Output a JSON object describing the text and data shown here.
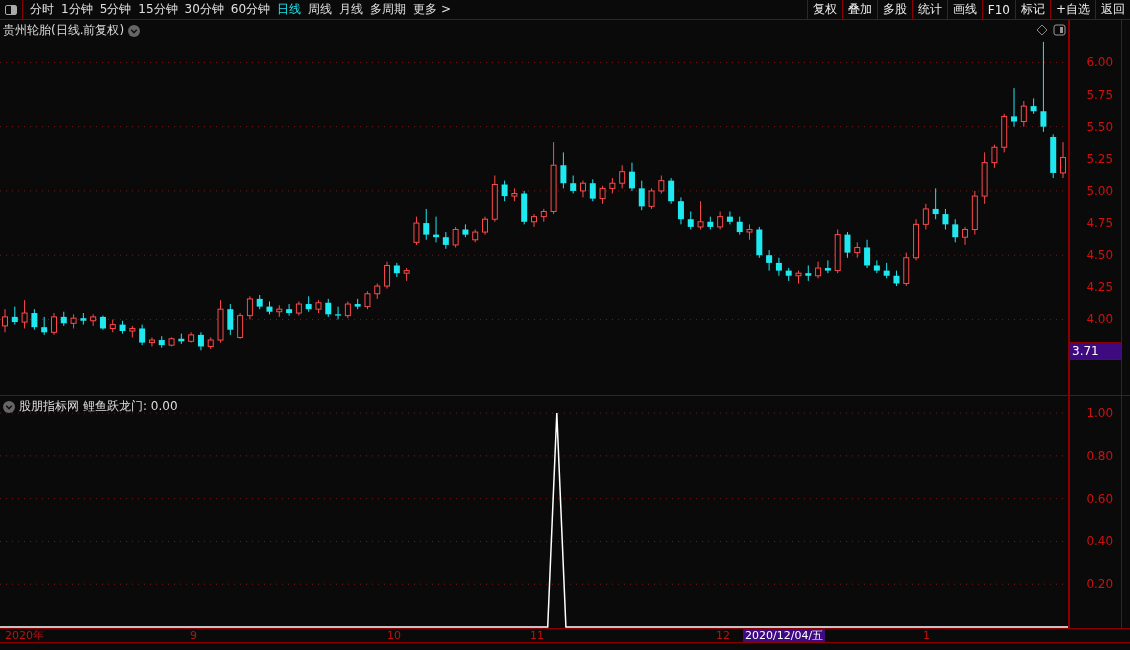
{
  "toolbar": {
    "periods": [
      {
        "label": "分时",
        "selected": false
      },
      {
        "label": "1分钟",
        "selected": false
      },
      {
        "label": "5分钟",
        "selected": false
      },
      {
        "label": "15分钟",
        "selected": false
      },
      {
        "label": "30分钟",
        "selected": false
      },
      {
        "label": "60分钟",
        "selected": false
      },
      {
        "label": "日线",
        "selected": true
      },
      {
        "label": "周线",
        "selected": false
      },
      {
        "label": "月线",
        "selected": false
      },
      {
        "label": "多周期",
        "selected": false
      },
      {
        "label": "更多 >",
        "selected": false
      }
    ],
    "actions": [
      "复权",
      "叠加",
      "多股",
      "统计",
      "画线",
      "F10",
      "标记",
      "+自选",
      "返回"
    ]
  },
  "main_chart": {
    "title": "贵州轮胎(日线.前复权)",
    "cursor_price": "3.71",
    "chart_data": {
      "type": "candlestick",
      "grid": true,
      "ylim": [
        3.42,
        6.33
      ],
      "yticks": [
        {
          "value": 6,
          "label": "6.00"
        },
        {
          "value": 5.75,
          "label": "5.75"
        },
        {
          "value": 5.5,
          "label": "5.50"
        },
        {
          "value": 5.25,
          "label": "5.25"
        },
        {
          "value": 5,
          "label": "5.00"
        },
        {
          "value": 4.75,
          "label": "4.75"
        },
        {
          "value": 4.5,
          "label": "4.50"
        },
        {
          "value": 4.25,
          "label": "4.25"
        },
        {
          "value": 4,
          "label": "4.00"
        }
      ],
      "ohlc": [
        [
          3.95,
          4.08,
          3.9,
          4.02
        ],
        [
          4.02,
          4.1,
          3.96,
          3.98
        ],
        [
          3.98,
          4.15,
          3.93,
          4.05
        ],
        [
          4.05,
          4.08,
          3.92,
          3.94
        ],
        [
          3.94,
          4.02,
          3.88,
          3.9
        ],
        [
          3.9,
          4.05,
          3.88,
          4.02
        ],
        [
          4.02,
          4.06,
          3.95,
          3.97
        ],
        [
          3.97,
          4.04,
          3.93,
          4.01
        ],
        [
          4.01,
          4.05,
          3.96,
          3.99
        ],
        [
          3.99,
          4.04,
          3.95,
          4.02
        ],
        [
          4.02,
          4.03,
          3.92,
          3.93
        ],
        [
          3.93,
          4.0,
          3.9,
          3.96
        ],
        [
          3.96,
          3.99,
          3.89,
          3.91
        ],
        [
          3.91,
          3.95,
          3.86,
          3.93
        ],
        [
          3.93,
          3.96,
          3.8,
          3.82
        ],
        [
          3.82,
          3.86,
          3.79,
          3.84
        ],
        [
          3.84,
          3.87,
          3.78,
          3.8
        ],
        [
          3.8,
          3.86,
          3.79,
          3.85
        ],
        [
          3.85,
          3.89,
          3.81,
          3.83
        ],
        [
          3.83,
          3.9,
          3.82,
          3.88
        ],
        [
          3.88,
          3.9,
          3.76,
          3.79
        ],
        [
          3.79,
          3.86,
          3.77,
          3.84
        ],
        [
          3.84,
          4.15,
          3.82,
          4.08
        ],
        [
          4.08,
          4.12,
          3.88,
          3.92
        ],
        [
          3.86,
          4.05,
          3.85,
          4.03
        ],
        [
          4.03,
          4.18,
          4.0,
          4.16
        ],
        [
          4.16,
          4.19,
          4.08,
          4.1
        ],
        [
          4.1,
          4.14,
          4.04,
          4.06
        ],
        [
          4.06,
          4.11,
          4.02,
          4.08
        ],
        [
          4.08,
          4.12,
          4.03,
          4.05
        ],
        [
          4.05,
          4.14,
          4.03,
          4.12
        ],
        [
          4.12,
          4.18,
          4.06,
          4.08
        ],
        [
          4.08,
          4.15,
          4.05,
          4.13
        ],
        [
          4.13,
          4.16,
          4.02,
          4.04
        ],
        [
          4.04,
          4.1,
          4.0,
          4.03
        ],
        [
          4.03,
          4.14,
          4.01,
          4.12
        ],
        [
          4.12,
          4.16,
          4.08,
          4.1
        ],
        [
          4.1,
          4.22,
          4.08,
          4.2
        ],
        [
          4.2,
          4.28,
          4.16,
          4.26
        ],
        [
          4.26,
          4.45,
          4.24,
          4.42
        ],
        [
          4.42,
          4.44,
          4.33,
          4.36
        ],
        [
          4.36,
          4.4,
          4.3,
          4.38
        ],
        [
          4.6,
          4.8,
          4.58,
          4.75
        ],
        [
          4.75,
          4.86,
          4.62,
          4.66
        ],
        [
          4.66,
          4.8,
          4.6,
          4.64
        ],
        [
          4.64,
          4.68,
          4.55,
          4.58
        ],
        [
          4.58,
          4.72,
          4.56,
          4.7
        ],
        [
          4.7,
          4.74,
          4.64,
          4.66
        ],
        [
          4.62,
          4.7,
          4.6,
          4.68
        ],
        [
          4.68,
          4.8,
          4.66,
          4.78
        ],
        [
          4.78,
          5.12,
          4.76,
          5.05
        ],
        [
          5.05,
          5.08,
          4.92,
          4.96
        ],
        [
          4.96,
          5.02,
          4.92,
          4.98
        ],
        [
          4.98,
          5.0,
          4.74,
          4.76
        ],
        [
          4.76,
          4.82,
          4.72,
          4.8
        ],
        [
          4.8,
          4.86,
          4.76,
          4.84
        ],
        [
          4.84,
          5.38,
          4.82,
          5.2
        ],
        [
          5.2,
          5.3,
          5.02,
          5.06
        ],
        [
          5.06,
          5.12,
          4.98,
          5.0
        ],
        [
          5.0,
          5.08,
          4.95,
          5.06
        ],
        [
          5.06,
          5.09,
          4.92,
          4.94
        ],
        [
          4.94,
          5.04,
          4.9,
          5.02
        ],
        [
          5.02,
          5.1,
          4.98,
          5.06
        ],
        [
          5.06,
          5.2,
          5.02,
          5.15
        ],
        [
          5.15,
          5.22,
          5.0,
          5.02
        ],
        [
          5.02,
          5.08,
          4.85,
          4.88
        ],
        [
          4.88,
          5.02,
          4.86,
          5.0
        ],
        [
          5.0,
          5.12,
          4.98,
          5.08
        ],
        [
          5.08,
          5.1,
          4.9,
          4.92
        ],
        [
          4.92,
          4.95,
          4.74,
          4.78
        ],
        [
          4.78,
          4.84,
          4.7,
          4.72
        ],
        [
          4.72,
          4.92,
          4.7,
          4.76
        ],
        [
          4.76,
          4.8,
          4.7,
          4.72
        ],
        [
          4.72,
          4.84,
          4.7,
          4.8
        ],
        [
          4.8,
          4.84,
          4.74,
          4.76
        ],
        [
          4.76,
          4.8,
          4.66,
          4.68
        ],
        [
          4.68,
          4.74,
          4.62,
          4.7
        ],
        [
          4.7,
          4.72,
          4.48,
          4.5
        ],
        [
          4.5,
          4.54,
          4.38,
          4.44
        ],
        [
          4.44,
          4.48,
          4.34,
          4.38
        ],
        [
          4.38,
          4.4,
          4.3,
          4.34
        ],
        [
          4.34,
          4.38,
          4.28,
          4.36
        ],
        [
          4.36,
          4.42,
          4.3,
          4.34
        ],
        [
          4.34,
          4.45,
          4.32,
          4.4
        ],
        [
          4.4,
          4.46,
          4.36,
          4.38
        ],
        [
          4.38,
          4.7,
          4.36,
          4.66
        ],
        [
          4.66,
          4.68,
          4.48,
          4.52
        ],
        [
          4.52,
          4.6,
          4.48,
          4.56
        ],
        [
          4.56,
          4.62,
          4.4,
          4.42
        ],
        [
          4.42,
          4.46,
          4.36,
          4.38
        ],
        [
          4.38,
          4.44,
          4.32,
          4.34
        ],
        [
          4.34,
          4.38,
          4.26,
          4.28
        ],
        [
          4.28,
          4.52,
          4.26,
          4.48
        ],
        [
          4.48,
          4.78,
          4.46,
          4.74
        ],
        [
          4.74,
          4.9,
          4.7,
          4.86
        ],
        [
          4.86,
          5.02,
          4.78,
          4.82
        ],
        [
          4.82,
          4.86,
          4.7,
          4.74
        ],
        [
          4.74,
          4.78,
          4.6,
          4.64
        ],
        [
          4.64,
          4.72,
          4.58,
          4.7
        ],
        [
          4.7,
          5.0,
          4.66,
          4.96
        ],
        [
          4.96,
          5.3,
          4.9,
          5.22
        ],
        [
          5.22,
          5.36,
          5.18,
          5.34
        ],
        [
          5.34,
          5.6,
          5.3,
          5.58
        ],
        [
          5.58,
          5.8,
          5.5,
          5.54
        ],
        [
          5.54,
          5.7,
          5.5,
          5.66
        ],
        [
          5.66,
          5.72,
          5.6,
          5.62
        ],
        [
          5.62,
          6.16,
          5.46,
          5.5
        ],
        [
          5.42,
          5.44,
          5.1,
          5.14
        ],
        [
          5.14,
          5.38,
          5.1,
          5.26
        ]
      ]
    }
  },
  "indicator": {
    "source": "股朋指标网",
    "reading": ": 0.00",
    "chart_data": {
      "type": "line",
      "series": [
        {
          "name": "鲤鱼跃龙门",
          "color": "#ffffff",
          "values": [
            0,
            0,
            0,
            0,
            0,
            0,
            0,
            0,
            0,
            0,
            0,
            0,
            0,
            0,
            0,
            0,
            0,
            0,
            0,
            0,
            0,
            0,
            0,
            0,
            0,
            0,
            0,
            0,
            0,
            0,
            0,
            0,
            0,
            0,
            0,
            0,
            0,
            0,
            0,
            0,
            0,
            0,
            0,
            0,
            0,
            0,
            0,
            0,
            0,
            0,
            0,
            0,
            0,
            0,
            0,
            0,
            0,
            0,
            0,
            0,
            0,
            1,
            0,
            0,
            0,
            0,
            0,
            0,
            0,
            0,
            0,
            0,
            0,
            0,
            0,
            0,
            0,
            0,
            0,
            0,
            0,
            0,
            0,
            0,
            0,
            0,
            0,
            0,
            0,
            0,
            0,
            0,
            0,
            0,
            0,
            0,
            0,
            0,
            0,
            0,
            0,
            0,
            0,
            0,
            0,
            0,
            0,
            0,
            0,
            0,
            0,
            0,
            0,
            0,
            0,
            0,
            0,
            0
          ]
        }
      ],
      "grid": true,
      "ylim": [
        0,
        1.08
      ],
      "yticks": [
        {
          "value": 1,
          "label": "1.00"
        },
        {
          "value": 0.8,
          "label": "0.80"
        },
        {
          "value": 0.6,
          "label": "0.60"
        },
        {
          "value": 0.4,
          "label": "0.40"
        },
        {
          "value": 0.2,
          "label": "0.20"
        }
      ]
    }
  },
  "time_axis": [
    {
      "label": "2020年",
      "selected": false
    },
    {
      "label": "9",
      "selected": false
    },
    {
      "label": "10",
      "selected": false
    },
    {
      "label": "11",
      "selected": false
    },
    {
      "label": "12",
      "selected": false
    },
    {
      "label": "2020/12/04/五",
      "selected": true
    },
    {
      "label": "1",
      "selected": false
    }
  ]
}
